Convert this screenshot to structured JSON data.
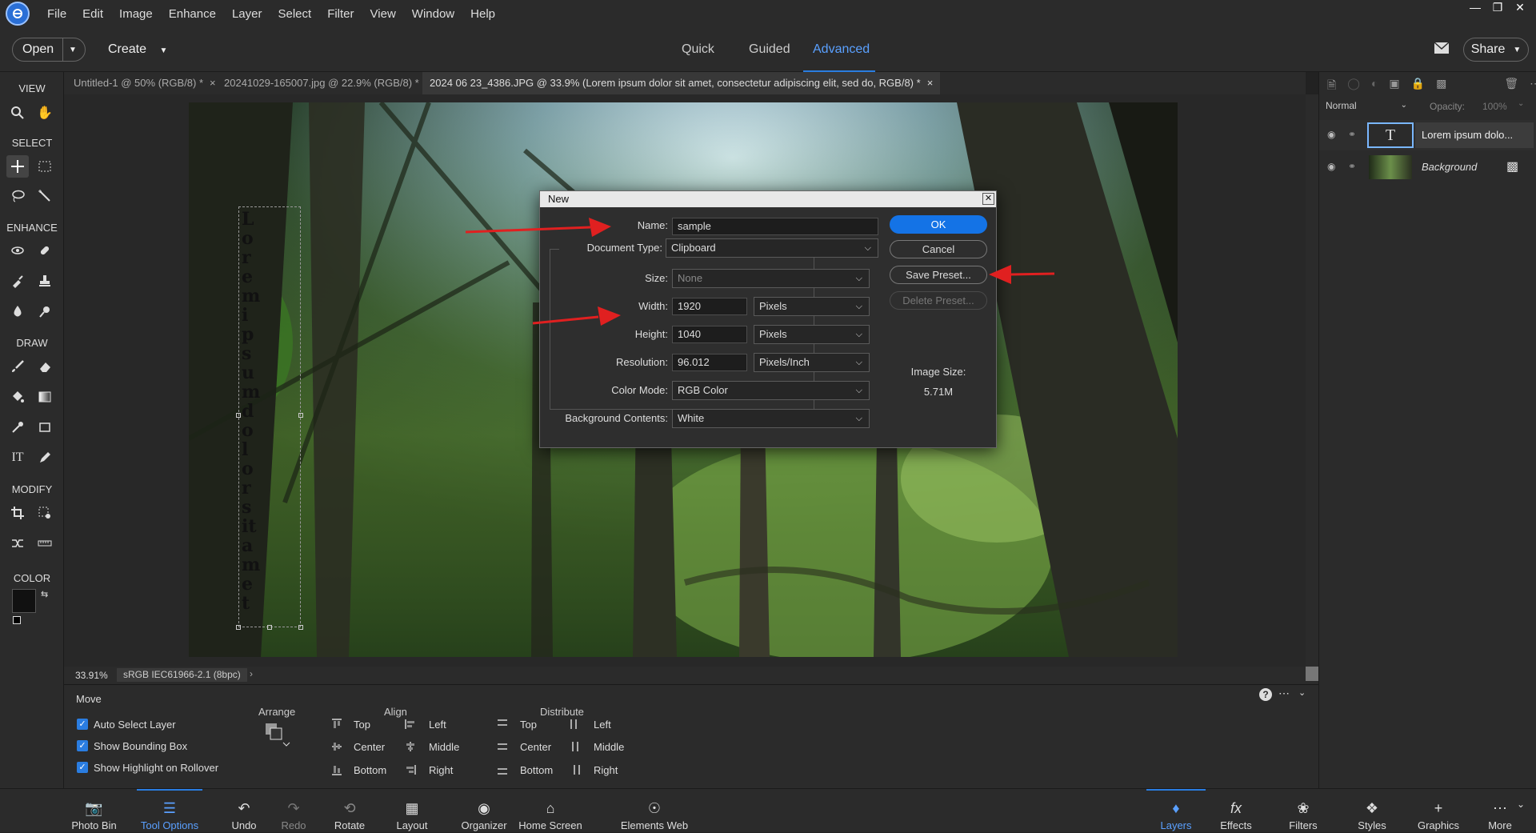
{
  "menubar": {
    "items": [
      "File",
      "Edit",
      "Image",
      "Enhance",
      "Layer",
      "Select",
      "Filter",
      "View",
      "Window",
      "Help"
    ],
    "window_controls": [
      "minimize",
      "restore",
      "close"
    ]
  },
  "header": {
    "open_label": "Open",
    "create_label": "Create",
    "modes": [
      "Quick",
      "Guided",
      "Advanced"
    ],
    "active_mode": "Advanced",
    "share_label": "Share"
  },
  "doc_tabs": [
    {
      "label": "Untitled-1 @ 50% (RGB/8) *"
    },
    {
      "label": "20241029-165007.jpg @ 22.9% (RGB/8) *"
    },
    {
      "label": "2024 06 23_4386.JPG @ 33.9% (Lorem ipsum dolor sit amet, consectetur adipiscing elit, sed do, RGB/8) *"
    }
  ],
  "toolbar": {
    "sections": [
      "VIEW",
      "SELECT",
      "ENHANCE",
      "DRAW",
      "MODIFY",
      "COLOR"
    ]
  },
  "canvas": {
    "vertical_text": "Lorem ipsum dolor sit amet"
  },
  "status": {
    "zoom": "33.91%",
    "profile": "sRGB IEC61966-2.1 (8bpc)"
  },
  "dialog": {
    "title": "New",
    "name_label": "Name:",
    "name_value": "sample",
    "doctype_label": "Document Type:",
    "doctype_value": "Clipboard",
    "size_label": "Size:",
    "size_value": "None",
    "width_label": "Width:",
    "width_value": "1920",
    "width_unit": "Pixels",
    "height_label": "Height:",
    "height_value": "1040",
    "height_unit": "Pixels",
    "resolution_label": "Resolution:",
    "resolution_value": "96.012",
    "resolution_unit": "Pixels/Inch",
    "colormode_label": "Color Mode:",
    "colormode_value": "RGB Color",
    "bg_label": "Background Contents:",
    "bg_value": "White",
    "ok_label": "OK",
    "cancel_label": "Cancel",
    "save_preset_label": "Save Preset...",
    "delete_preset_label": "Delete Preset...",
    "image_size_label": "Image Size:",
    "image_size_value": "5.71M"
  },
  "layers_panel": {
    "blend_mode": "Normal",
    "opacity_label": "Opacity:",
    "opacity_value": "100%",
    "layers": [
      {
        "name": "Lorem ipsum dolo...",
        "type": "text"
      },
      {
        "name": "Background",
        "type": "image"
      }
    ]
  },
  "tool_options": {
    "tool_name": "Move",
    "checkboxes": [
      "Auto Select Layer",
      "Show Bounding Box",
      "Show Highlight on Rollover"
    ],
    "arrange_label": "Arrange",
    "align_label": "Align",
    "align_items": [
      "Top",
      "Center",
      "Bottom",
      "Left",
      "Middle",
      "Right"
    ],
    "distribute_label": "Distribute",
    "distribute_items": [
      "Top",
      "Center",
      "Bottom",
      "Left",
      "Middle",
      "Right"
    ]
  },
  "bottom_bar": {
    "left": [
      "Photo Bin",
      "Tool Options",
      "Undo",
      "Redo",
      "Rotate",
      "Layout",
      "Organizer",
      "Home Screen",
      "Elements Web"
    ],
    "right": [
      "Layers",
      "Effects",
      "Filters",
      "Styles",
      "Graphics",
      "More"
    ],
    "active_left": "Tool Options",
    "active_right": "Layers"
  },
  "colors": {
    "accent": "#2a7de1",
    "arrow": "#e02020"
  }
}
